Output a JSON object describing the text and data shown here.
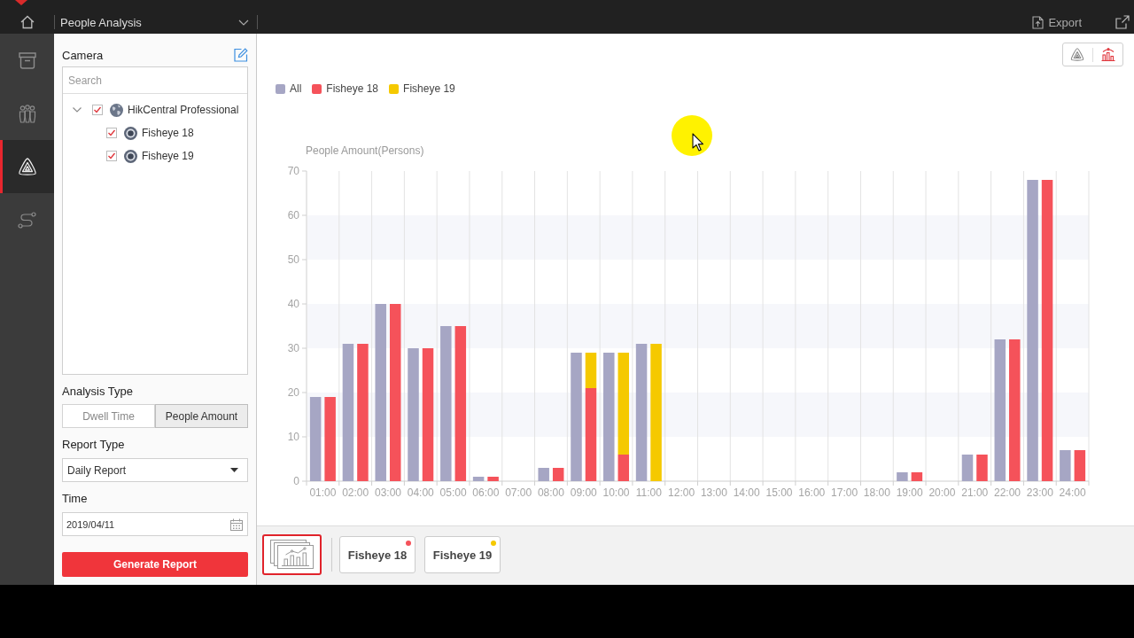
{
  "top_bar": {
    "module": "People Analysis",
    "export": "Export"
  },
  "nav_rail": [
    {
      "kind": "storage",
      "selected": false
    },
    {
      "kind": "people",
      "selected": false
    },
    {
      "kind": "analysis",
      "selected": true
    },
    {
      "kind": "route",
      "selected": false
    }
  ],
  "camera_panel": {
    "title": "Camera",
    "search": {
      "placeholder": "Search"
    },
    "tree": [
      {
        "kind": "site",
        "label": "HikCentral Professional",
        "checked": true,
        "expanded": true,
        "children": [
          {
            "kind": "camera",
            "label": "Fisheye 18",
            "checked": true
          },
          {
            "kind": "camera",
            "label": "Fisheye 19",
            "checked": true
          }
        ]
      }
    ]
  },
  "analysis_type": {
    "label": "Analysis Type",
    "options": [
      {
        "label": "Dwell Time",
        "selected": false
      },
      {
        "label": "People Amount",
        "selected": true
      }
    ]
  },
  "report_type": {
    "label": "Report Type",
    "value": "Daily Report"
  },
  "time": {
    "label": "Time",
    "value": "2019/04/11"
  },
  "generate_button": "Generate Report",
  "chart_panel": {
    "view_toggle": [
      {
        "kind": "analysis",
        "selected": false
      },
      {
        "kind": "chart",
        "selected": true
      }
    ],
    "chart_data": {
      "type": "bar",
      "ylabel": "People Amount(Persons)",
      "categories": [
        "01:00",
        "02:00",
        "03:00",
        "04:00",
        "05:00",
        "06:00",
        "07:00",
        "08:00",
        "09:00",
        "10:00",
        "11:00",
        "12:00",
        "13:00",
        "14:00",
        "15:00",
        "16:00",
        "17:00",
        "18:00",
        "19:00",
        "20:00",
        "21:00",
        "22:00",
        "23:00",
        "24:00"
      ],
      "ylim": [
        0,
        70
      ],
      "yticks": [
        0,
        10,
        20,
        30,
        40,
        50,
        60,
        70
      ],
      "series": [
        {
          "name": "All",
          "color": "#a6a6c4",
          "values": [
            19,
            31,
            40,
            30,
            35,
            1,
            0,
            3,
            29,
            29,
            31,
            0,
            0,
            0,
            0,
            0,
            0,
            0,
            2,
            0,
            6,
            32,
            68,
            7
          ]
        }
      ]
    },
    "camera_stack": {
      "chart_data": {
        "type": "bar",
        "stacked": true,
        "ylim": [
          0,
          70
        ],
        "series": [
          {
            "name": "Fisheye 18",
            "color": "#f5525a",
            "values": [
              19,
              31,
              40,
              30,
              35,
              1,
              0,
              3,
              21,
              6,
              0,
              0,
              0,
              0,
              0,
              0,
              0,
              0,
              2,
              0,
              6,
              32,
              68,
              7
            ]
          },
          {
            "name": "Fisheye 19",
            "color": "#f5c900",
            "values": [
              0,
              0,
              0,
              0,
              0,
              0,
              0,
              0,
              8,
              23,
              31,
              0,
              0,
              0,
              0,
              0,
              0,
              0,
              0,
              0,
              0,
              0,
              0,
              0
            ]
          }
        ]
      }
    }
  },
  "report_tabs": [
    {
      "kind": "overview",
      "selected": true
    },
    {
      "kind": "camera",
      "label": "Fisheye 18",
      "color": "#f5525a",
      "selected": false
    },
    {
      "kind": "camera",
      "label": "Fisheye 19",
      "color": "#f5c900",
      "selected": false
    }
  ]
}
